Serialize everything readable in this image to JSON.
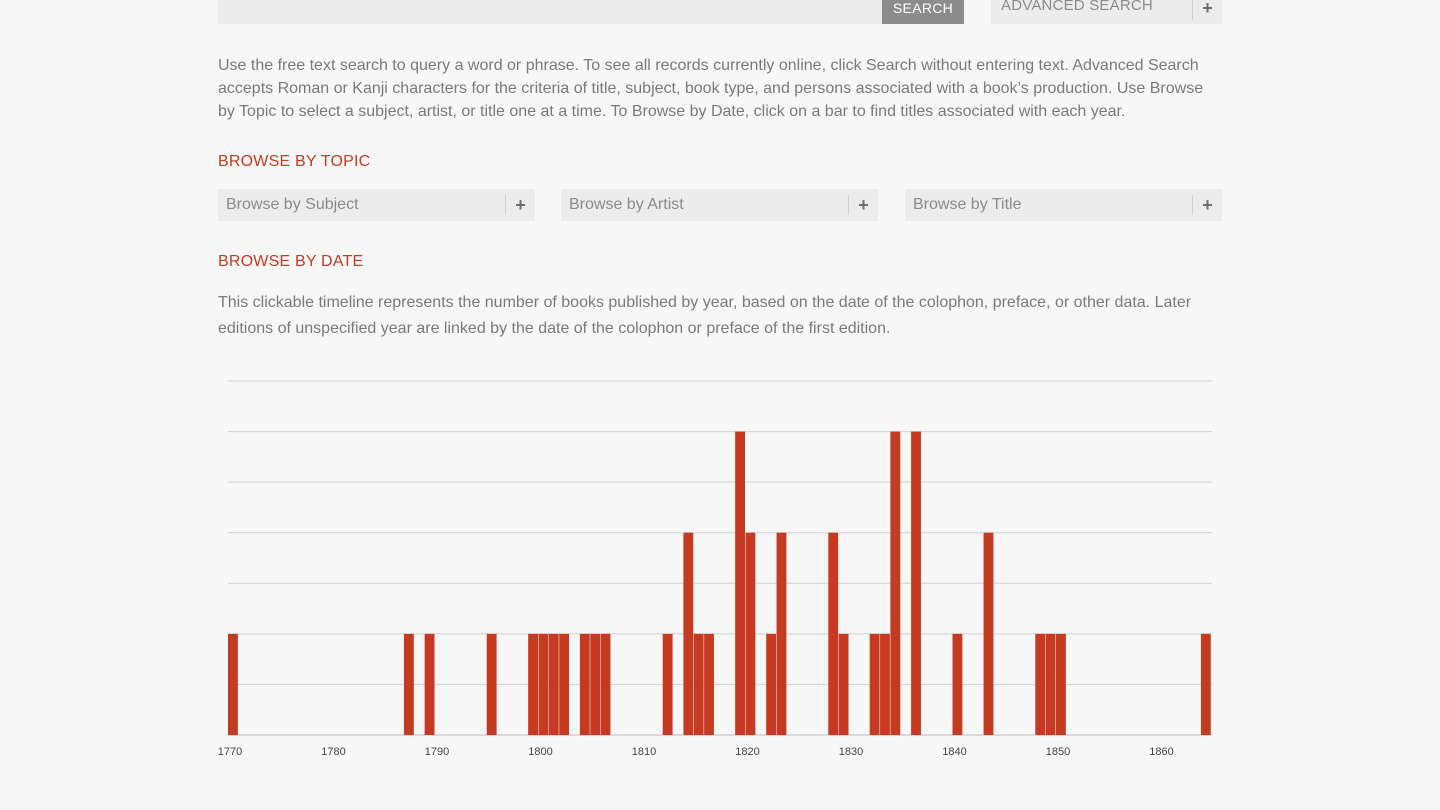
{
  "search": {
    "button_label": "SEARCH"
  },
  "advanced_search": {
    "label": "ADVANCED SEARCH"
  },
  "intro_text": "Use the free text search to query a word or phrase. To see all records currently online, click Search without entering text. Advanced Search accepts Roman or Kanji characters for the criteria of title, subject, book type, and persons associated with a book’s production. Use Browse by Topic to select a subject, artist, or title one at a time. To Browse by Date, click on a bar to find titles associated with each year.",
  "browse_topic": {
    "heading": "BROWSE BY TOPIC",
    "subject_label": "Browse by Subject",
    "artist_label": "Browse by Artist",
    "title_label": "Browse by Title"
  },
  "browse_date": {
    "heading": "BROWSE BY DATE",
    "description": "This clickable timeline represents the number of books published by year, based on the date of the colophon, preface, or other data. Later editions of unspecified year are linked by the date of the colophon or preface of the first edition."
  },
  "colors": {
    "accent": "#c63a22",
    "bar": "#c63a22",
    "grid": "#cfcfcf"
  },
  "chart_data": {
    "type": "bar",
    "title": "",
    "xlabel": "",
    "ylabel": "",
    "xlim": [
      1770,
      1865
    ],
    "ylim": [
      0,
      7
    ],
    "grid": true,
    "x_ticks": [
      1770,
      1780,
      1790,
      1800,
      1810,
      1820,
      1830,
      1840,
      1850,
      1860
    ],
    "years": [
      1770,
      1787,
      1789,
      1795,
      1799,
      1800,
      1801,
      1802,
      1804,
      1805,
      1806,
      1812,
      1814,
      1815,
      1816,
      1819,
      1820,
      1822,
      1823,
      1828,
      1829,
      1832,
      1833,
      1834,
      1836,
      1840,
      1843,
      1848,
      1849,
      1850,
      1864
    ],
    "values": [
      2,
      2,
      2,
      2,
      2,
      2,
      2,
      2,
      2,
      2,
      2,
      2,
      4,
      2,
      2,
      6,
      4,
      2,
      4,
      4,
      2,
      2,
      2,
      6,
      6,
      2,
      4,
      2,
      2,
      2,
      2
    ]
  }
}
